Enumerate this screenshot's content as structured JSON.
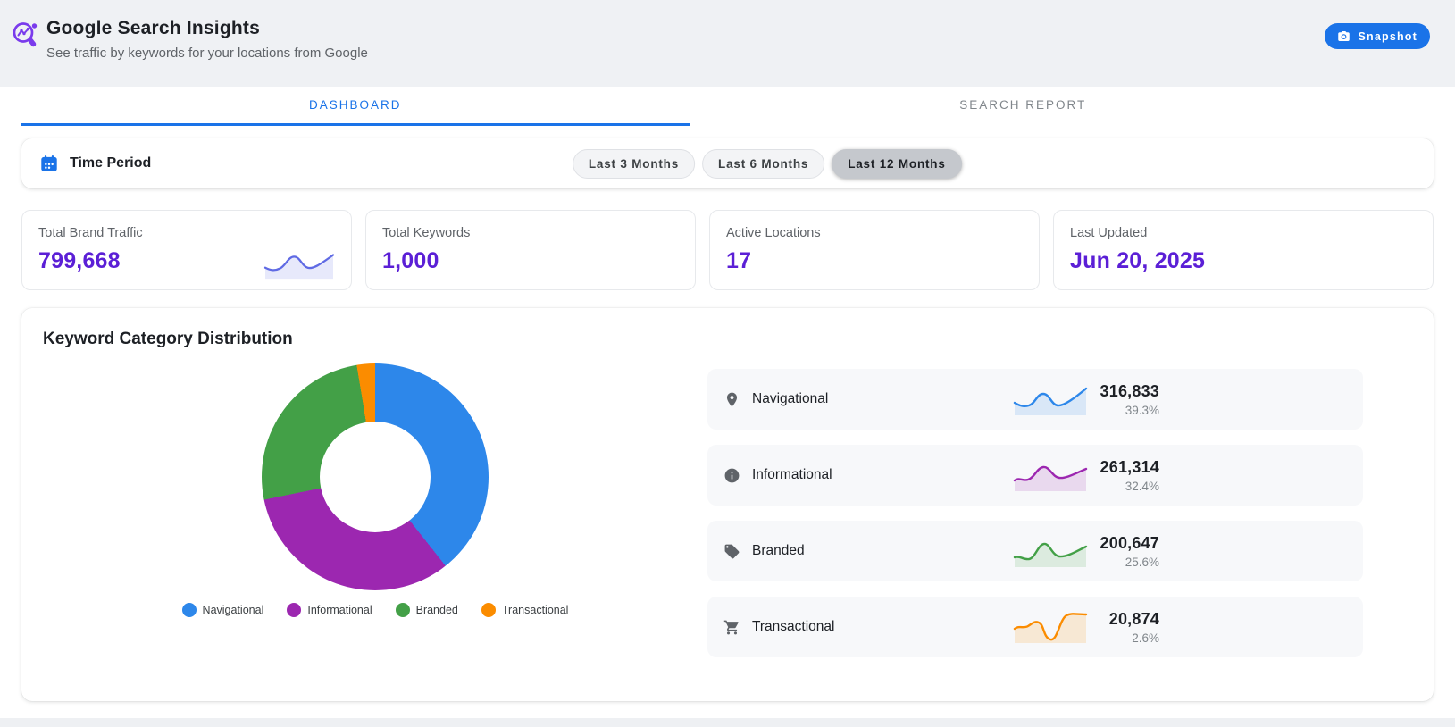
{
  "header": {
    "title": "Google Search Insights",
    "subtitle": "See traffic by keywords for your locations from Google",
    "snapshot_label": "Snapshot"
  },
  "tabs": [
    {
      "label": "DASHBOARD",
      "active": true
    },
    {
      "label": "SEARCH REPORT",
      "active": false
    }
  ],
  "time_period": {
    "label": "Time Period",
    "options": [
      {
        "label": "Last 3 Months",
        "selected": false
      },
      {
        "label": "Last 6 Months",
        "selected": false
      },
      {
        "label": "Last 12 Months",
        "selected": true
      }
    ]
  },
  "stats": [
    {
      "label": "Total Brand Traffic",
      "value": "799,668"
    },
    {
      "label": "Total Keywords",
      "value": "1,000"
    },
    {
      "label": "Active Locations",
      "value": "17"
    },
    {
      "label": "Last Updated",
      "value": "Jun 20, 2025"
    }
  ],
  "distribution": {
    "title": "Keyword Category Distribution",
    "rows": [
      {
        "label": "Navigational",
        "value": "316,833",
        "percent": "39.3%",
        "color": "#2d87ea",
        "icon": "location-pin"
      },
      {
        "label": "Informational",
        "value": "261,314",
        "percent": "32.4%",
        "color": "#9c27b0",
        "icon": "info"
      },
      {
        "label": "Branded",
        "value": "200,647",
        "percent": "25.6%",
        "color": "#43a047",
        "icon": "tag"
      },
      {
        "label": "Transactional",
        "value": "20,874",
        "percent": "2.6%",
        "color": "#fb8c00",
        "icon": "shopping-cart"
      }
    ]
  },
  "chart_data": {
    "type": "pie",
    "donut": true,
    "title": "Keyword Category Distribution",
    "categories": [
      "Navigational",
      "Informational",
      "Branded",
      "Transactional"
    ],
    "values": [
      39.3,
      32.4,
      25.6,
      2.6
    ],
    "traffic_counts": [
      316833,
      261314,
      200647,
      20874
    ],
    "colors": [
      "#2d87ea",
      "#9c27b0",
      "#43a047",
      "#fb8c00"
    ],
    "legend_position": "bottom"
  },
  "colors": {
    "accent_blue": "#1a73e8",
    "stat_value_purple": "#5b1fd6",
    "sparkline_indigo": "#5f6ae4",
    "header_background": "#eff1f4"
  }
}
